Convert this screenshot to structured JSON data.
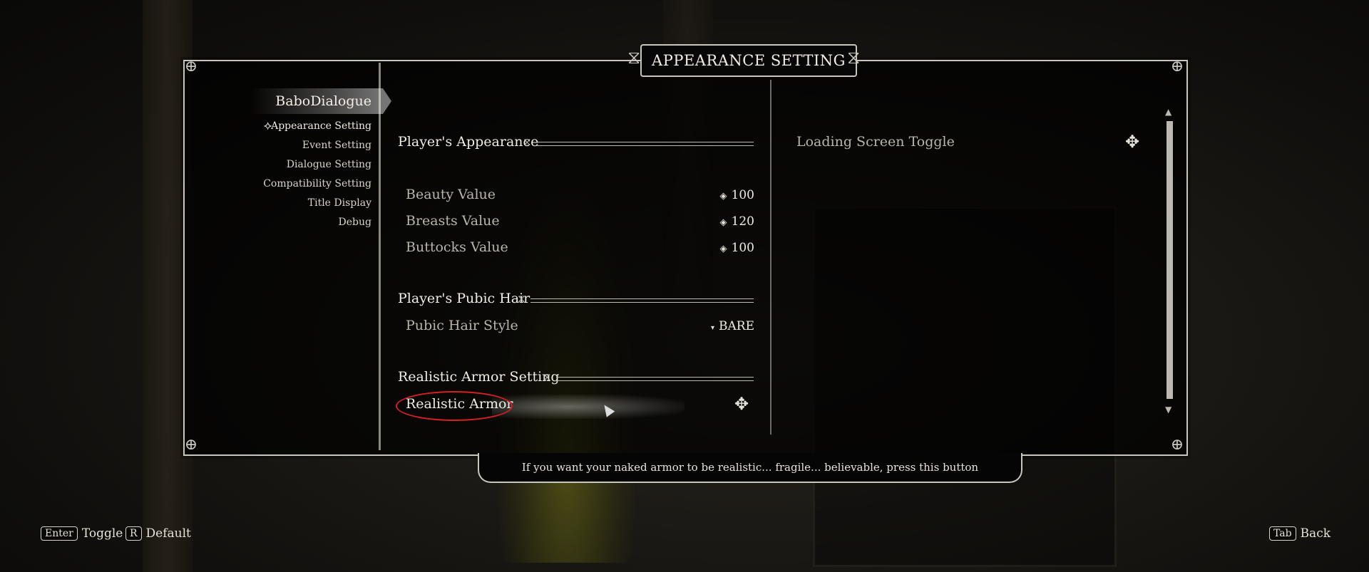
{
  "title": "APPEARANCE SETTING",
  "sidebar": {
    "mod_name": "BaboDialogue",
    "items": [
      {
        "label": "Appearance Setting",
        "active": true
      },
      {
        "label": "Event Setting"
      },
      {
        "label": "Dialogue Setting"
      },
      {
        "label": "Compatibility Setting"
      },
      {
        "label": "Title Display"
      },
      {
        "label": "Debug"
      }
    ]
  },
  "left_column": {
    "sections": [
      {
        "header": "Player's Appearance",
        "rows": [
          {
            "label": "Beauty Value",
            "value": "100"
          },
          {
            "label": "Breasts Value",
            "value": "120"
          },
          {
            "label": "Buttocks Value",
            "value": "100"
          }
        ]
      },
      {
        "header": "Player's Pubic Hair",
        "rows": [
          {
            "label": "Pubic Hair Style",
            "value": "BARE"
          }
        ]
      },
      {
        "header": "Realistic Armor Setting",
        "rows": [
          {
            "label": "Realistic Armor",
            "value": ""
          }
        ]
      }
    ]
  },
  "right_column": {
    "rows": [
      {
        "label": "Loading Screen Toggle"
      }
    ]
  },
  "description": "If you want your naked armor to be realistic... fragile... believable, press this button",
  "hints": {
    "toggle_key": "Enter",
    "toggle_label": "Toggle",
    "default_key": "R",
    "default_label": "Default",
    "back_key": "Tab",
    "back_label": "Back"
  },
  "colors": {
    "frame": "#c9c6bd",
    "highlight": "#d52020",
    "panel": "rgba(0,0,0,.72)"
  },
  "icons": {
    "toggle": "knot-toggle-icon",
    "slider": "diamond-icon",
    "menu": "dropdown-dot-icon"
  }
}
